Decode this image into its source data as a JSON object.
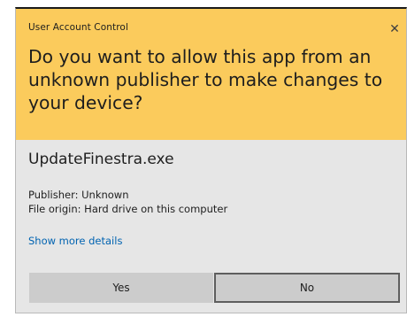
{
  "window": {
    "title": "User Account Control",
    "close_glyph": "✕"
  },
  "prompt": {
    "question": "Do you want to allow this app from an unknown publisher to make changes to your device?"
  },
  "app": {
    "name": "UpdateFinestra.exe",
    "publisher": "Publisher: Unknown",
    "origin": "File origin: Hard drive on this computer"
  },
  "details_link": "Show more details",
  "buttons": {
    "yes": "Yes",
    "no": "No"
  },
  "colors": {
    "header": "#fbcb5c",
    "body": "#e6e6e6",
    "link": "#0063b1",
    "button": "#cccccc"
  },
  "icons": {
    "close": "close-icon"
  }
}
